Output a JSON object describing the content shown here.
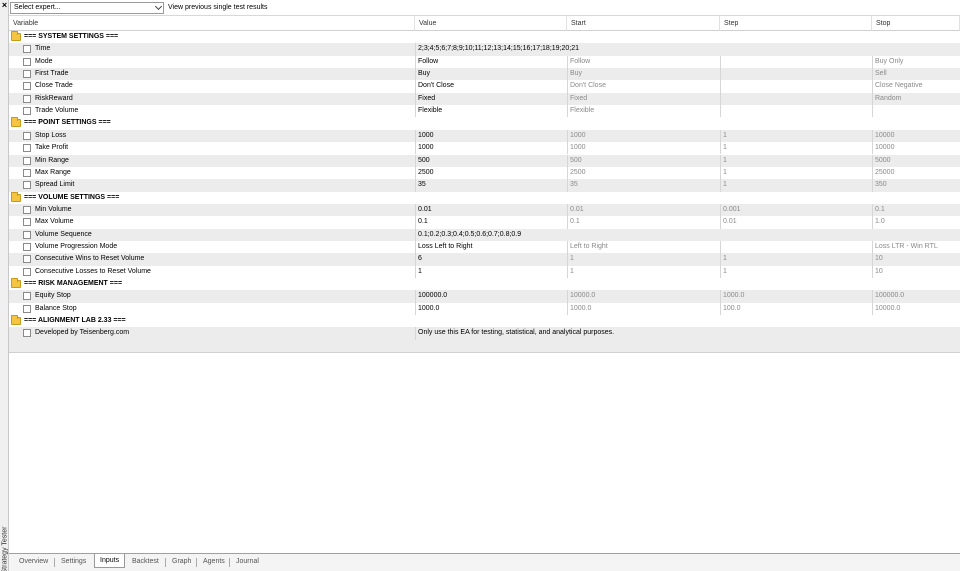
{
  "sidebar": {
    "close_glyph": "×",
    "title": "Strategy Tester"
  },
  "toolbar": {
    "expert_select_value": "Select expert...",
    "view_previous_label": "View previous single test results"
  },
  "table": {
    "headers": [
      "Variable",
      "Value",
      "Start",
      "Step",
      "Stop"
    ],
    "rows": [
      {
        "type": "group",
        "label": "=== SYSTEM SETTINGS ==="
      },
      {
        "type": "item",
        "variable": "Time",
        "value": "2;3;4;5;6;7;8;9;10;11;12;13;14;15;16;17;18;19;20;21",
        "start": "",
        "step": "",
        "stop": "",
        "wide": true
      },
      {
        "type": "item",
        "variable": "Mode",
        "value": "Follow",
        "start": "Follow",
        "step": "",
        "stop": "Buy Only"
      },
      {
        "type": "item",
        "variable": "First Trade",
        "value": "Buy",
        "start": "Buy",
        "step": "",
        "stop": "Sell"
      },
      {
        "type": "item",
        "variable": "Close Trade",
        "value": "Don't Close",
        "start": "Don't Close",
        "step": "",
        "stop": "Close Negative"
      },
      {
        "type": "item",
        "variable": "RiskReward",
        "value": "Fixed",
        "start": "Fixed",
        "step": "",
        "stop": "Random"
      },
      {
        "type": "item",
        "variable": "Trade Volume",
        "value": "Flexible",
        "start": "Flexible",
        "step": "",
        "stop": ""
      },
      {
        "type": "group",
        "label": "=== POINT SETTINGS ==="
      },
      {
        "type": "item",
        "variable": "Stop Loss",
        "value": "1000",
        "start": "1000",
        "step": "1",
        "stop": "10000"
      },
      {
        "type": "item",
        "variable": "Take Profit",
        "value": "1000",
        "start": "1000",
        "step": "1",
        "stop": "10000"
      },
      {
        "type": "item",
        "variable": "Min Range",
        "value": "500",
        "start": "500",
        "step": "1",
        "stop": "5000"
      },
      {
        "type": "item",
        "variable": "Max Range",
        "value": "2500",
        "start": "2500",
        "step": "1",
        "stop": "25000"
      },
      {
        "type": "item",
        "variable": "Spread Limit",
        "value": "35",
        "start": "35",
        "step": "1",
        "stop": "350"
      },
      {
        "type": "group",
        "label": "=== VOLUME SETTINGS ==="
      },
      {
        "type": "item",
        "variable": "Min Volume",
        "value": "0.01",
        "start": "0.01",
        "step": "0.001",
        "stop": "0.1"
      },
      {
        "type": "item",
        "variable": "Max Volume",
        "value": "0.1",
        "start": "0.1",
        "step": "0.01",
        "stop": "1.0"
      },
      {
        "type": "item",
        "variable": "Volume Sequence",
        "value": "0.1;0.2;0.3;0.4;0.5;0.6;0.7;0.8;0.9",
        "start": "",
        "step": "",
        "stop": "",
        "wide": true
      },
      {
        "type": "item",
        "variable": "Volume Progression Mode",
        "value": "Loss Left to Right",
        "start": "Left to Right",
        "step": "",
        "stop": "Loss LTR - Win RTL"
      },
      {
        "type": "item",
        "variable": "Consecutive Wins to Reset Volume",
        "value": "6",
        "start": "1",
        "step": "1",
        "stop": "10"
      },
      {
        "type": "item",
        "variable": "Consecutive Losses to Reset Volume",
        "value": "1",
        "start": "1",
        "step": "1",
        "stop": "10"
      },
      {
        "type": "group",
        "label": "=== RISK MANAGEMENT ==="
      },
      {
        "type": "item",
        "variable": "Equity Stop",
        "value": "100000.0",
        "start": "10000.0",
        "step": "1000.0",
        "stop": "100000.0"
      },
      {
        "type": "item",
        "variable": "Balance Stop",
        "value": "1000.0",
        "start": "1000.0",
        "step": "100.0",
        "stop": "10000.0"
      },
      {
        "type": "group",
        "label": "=== ALIGNMENT LAB 2.33 ==="
      },
      {
        "type": "item",
        "variable": "Developed by Teisenberg.com",
        "value": "Only use this EA for testing, statistical, and analytical purposes.",
        "start": "",
        "step": "",
        "stop": "",
        "wide": true
      }
    ]
  },
  "tabs": [
    {
      "label": "Overview",
      "active": false
    },
    {
      "label": "Settings",
      "active": false
    },
    {
      "label": "Inputs",
      "active": true
    },
    {
      "label": "Backtest",
      "active": false
    },
    {
      "label": "Graph",
      "active": false
    },
    {
      "label": "Agents",
      "active": false
    },
    {
      "label": "Journal",
      "active": false
    }
  ],
  "colors": {
    "alt_row": "#ececec",
    "folder": "#f4c542",
    "dim_text": "#8a8a8a"
  }
}
